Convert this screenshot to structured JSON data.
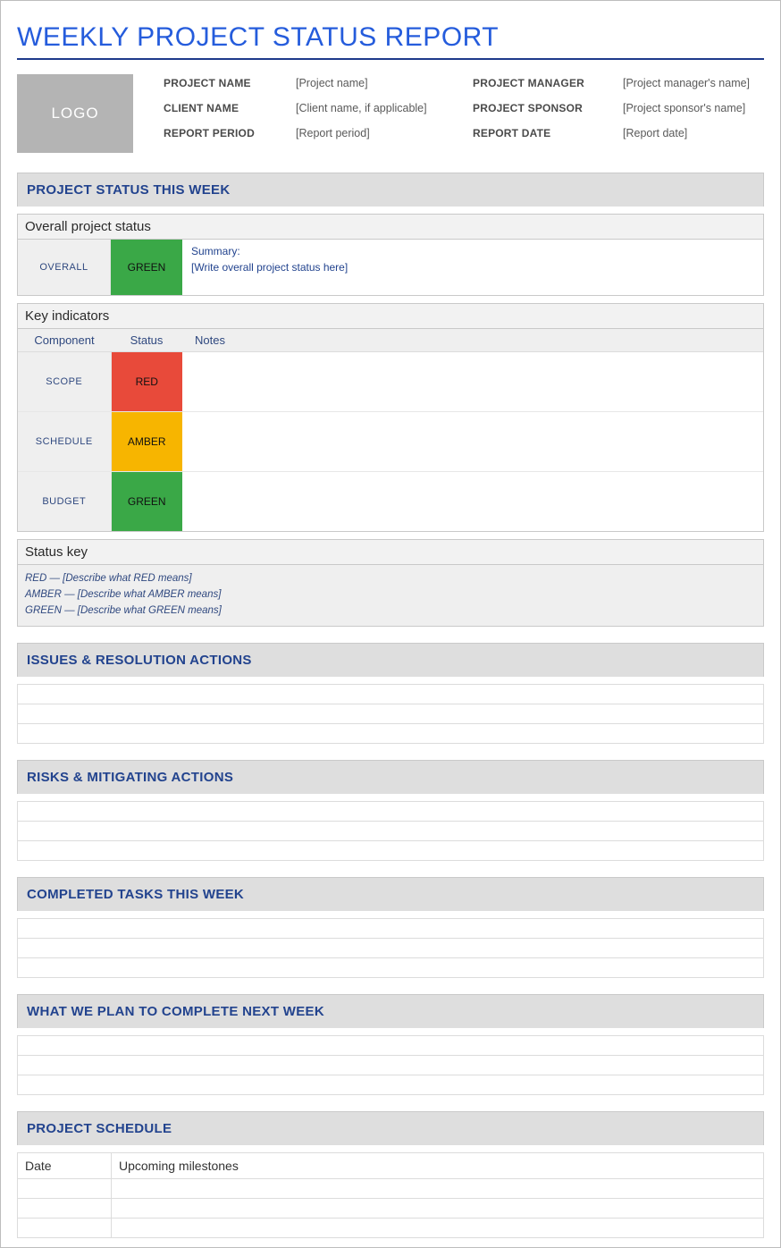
{
  "title": "WEEKLY PROJECT STATUS REPORT",
  "logo_text": "LOGO",
  "meta": {
    "project_name_label": "PROJECT NAME",
    "project_name_value": "[Project name]",
    "client_name_label": "CLIENT NAME",
    "client_name_value": "[Client name, if applicable]",
    "report_period_label": "REPORT PERIOD",
    "report_period_value": "[Report period]",
    "project_manager_label": "PROJECT MANAGER",
    "project_manager_value": "[Project manager's name]",
    "project_sponsor_label": "PROJECT SPONSOR",
    "project_sponsor_value": "[Project sponsor's name]",
    "report_date_label": "REPORT DATE",
    "report_date_value": "[Report date]"
  },
  "sections": {
    "status_this_week": "PROJECT STATUS THIS WEEK",
    "issues": "ISSUES & RESOLUTION ACTIONS",
    "risks": "RISKS & MITIGATING ACTIONS",
    "completed": "COMPLETED TASKS THIS WEEK",
    "plan_next": "WHAT WE PLAN TO COMPLETE NEXT WEEK",
    "schedule": "PROJECT SCHEDULE"
  },
  "overall": {
    "subtitle": "Overall project status",
    "row_label": "OVERALL",
    "status": "GREEN",
    "status_class": "green",
    "summary_label": "Summary:",
    "summary_text": "[Write overall project status here]"
  },
  "indicators": {
    "subtitle": "Key indicators",
    "headers": {
      "component": "Component",
      "status": "Status",
      "notes": "Notes"
    },
    "rows": [
      {
        "component": "SCOPE",
        "status": "RED",
        "status_class": "red",
        "notes": ""
      },
      {
        "component": "SCHEDULE",
        "status": "AMBER",
        "status_class": "amber",
        "notes": ""
      },
      {
        "component": "BUDGET",
        "status": "GREEN",
        "status_class": "green",
        "notes": ""
      }
    ]
  },
  "status_key": {
    "subtitle": "Status key",
    "lines": [
      "RED — [Describe what RED means]",
      "AMBER — [Describe what AMBER means]",
      "GREEN — [Describe what GREEN means]"
    ]
  },
  "schedule_table": {
    "date_header": "Date",
    "milestones_header": "Upcoming milestones"
  }
}
